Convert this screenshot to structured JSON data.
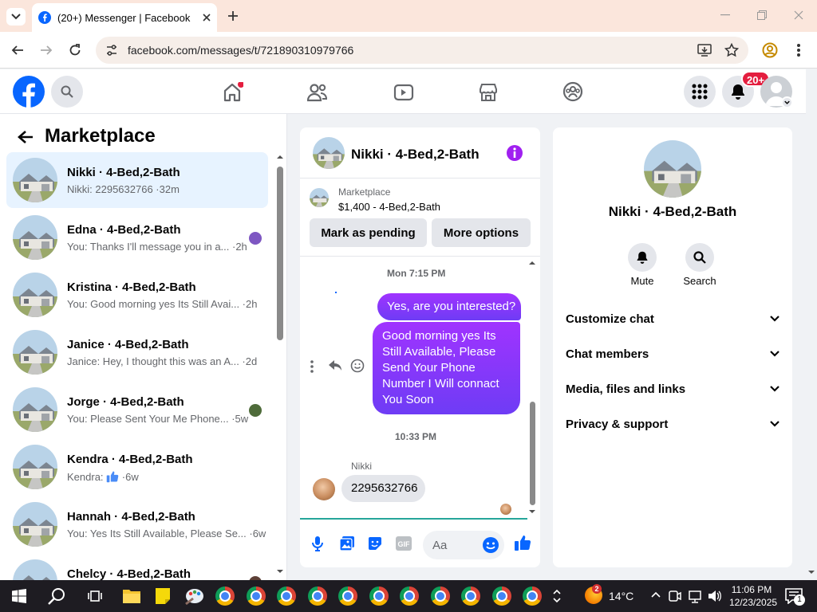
{
  "browser": {
    "tab_title": "(20+) Messenger | Facebook",
    "url": "facebook.com/messages/t/721890310979766"
  },
  "fb_header": {
    "notifications_badge": "20+"
  },
  "sidebar": {
    "title": "Marketplace",
    "conversations": [
      {
        "name": "Nikki · 4-Bed,2-Bath",
        "preview": "Nikki: 2295632766 ·32m",
        "active": true
      },
      {
        "name": "Edna · 4-Bed,2-Bath",
        "preview": "You: Thanks I'll message you in a... ·2h"
      },
      {
        "name": "Kristina · 4-Bed,2-Bath",
        "preview": "You: Good morning yes Its Still Avai... ·2h"
      },
      {
        "name": "Janice · 4-Bed,2-Bath",
        "preview": "Janice: Hey, I thought this was an A... ·2d"
      },
      {
        "name": "Jorge · 4-Bed,2-Bath",
        "preview": "You: Please Sent Your Me Phone... ·5w"
      },
      {
        "name": "Kendra · 4-Bed,2-Bath",
        "preview_prefix": "Kendra:",
        "preview_suffix": "·6w"
      },
      {
        "name": "Hannah · 4-Bed,2-Bath",
        "preview": "You: Yes Its Still Available, Please Se... ·6w"
      },
      {
        "name": "Chelcy · 4-Bed,2-Bath",
        "preview": ""
      }
    ]
  },
  "chat": {
    "header_name": "Nikki · 4-Bed,2-Bath",
    "marketplace_label": "Marketplace",
    "listing": "$1,400 - 4-Bed,2-Bath",
    "mark_pending": "Mark as pending",
    "more_options": "More options",
    "ts1": "Mon 7:15 PM",
    "msg_out_1": "Yes, are you interested?",
    "msg_out_2": "Good morning yes Its Still Available, Please Send Your Phone Number I Will connact You Soon",
    "ts2": "10:33 PM",
    "sender": "Nikki",
    "msg_in_1": "2295632766",
    "input_placeholder": "Aa"
  },
  "details": {
    "name": "Nikki · 4-Bed,2-Bath",
    "mute": "Mute",
    "search": "Search",
    "sections": [
      "Customize chat",
      "Chat members",
      "Media, files and links",
      "Privacy & support"
    ]
  },
  "taskbar": {
    "weather_temp": "14°C",
    "weather_badge": "2",
    "time": "11:06 PM",
    "date": "12/23/2025",
    "notification_count": "1"
  },
  "colors": {
    "accent": "#0866ff",
    "bubble_top": "#a033ff",
    "bubble_bottom": "#6e3cf5",
    "active_row": "#e7f3ff",
    "info_icon": "#a020f0"
  }
}
